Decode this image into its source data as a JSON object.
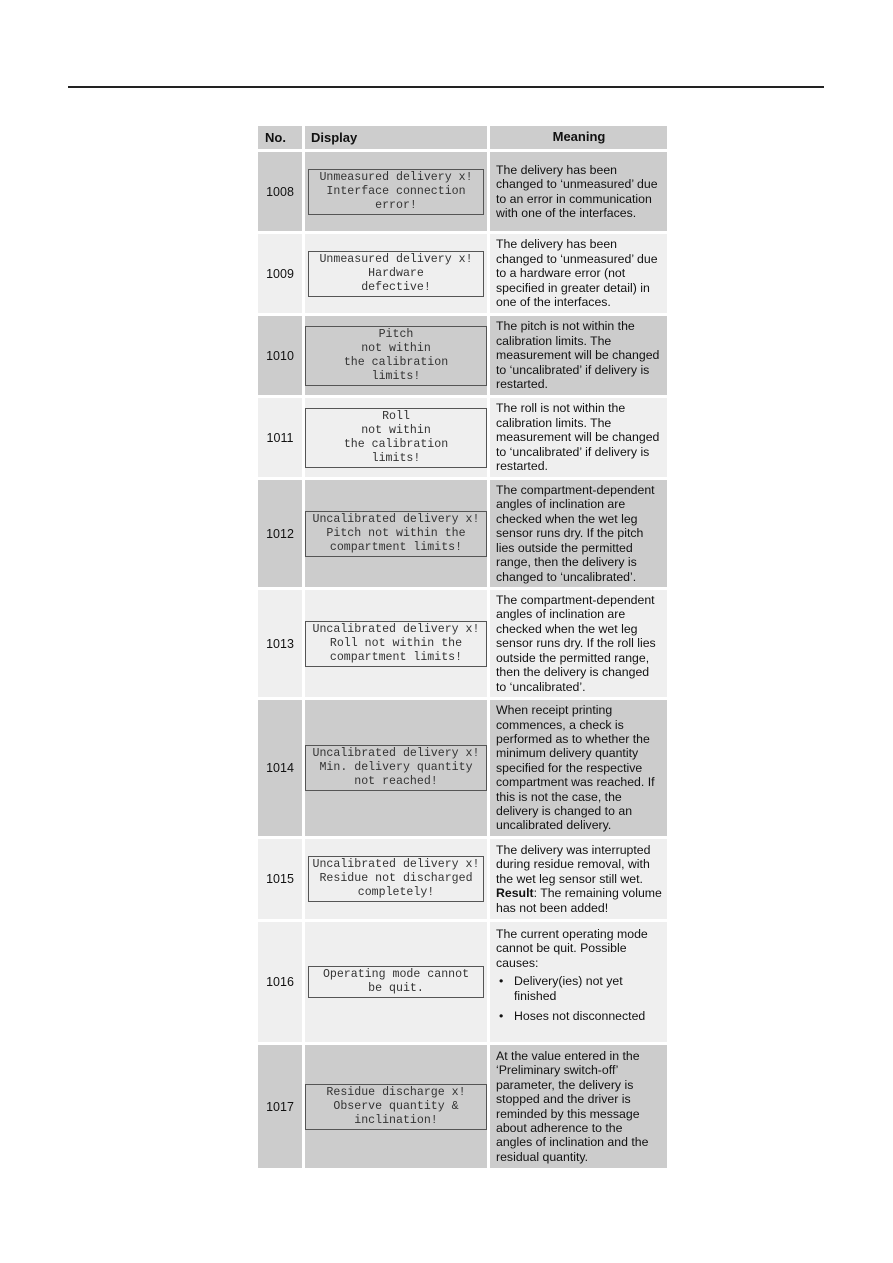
{
  "table": {
    "headers": {
      "no": "No.",
      "display": "Display",
      "meaning": "Meaning"
    },
    "rows": [
      {
        "no": "1008",
        "display": "Unmeasured delivery x!\nInterface connection\nerror!",
        "meaning": "The delivery has been changed to ‘unmeasured’ due to an error in communication with one of the interfaces."
      },
      {
        "no": "1009",
        "display": "Unmeasured delivery x!\nHardware\ndefective!",
        "meaning": "The delivery has been changed to ‘unmeasured’ due to a hardware error (not specified in greater detail) in one of the interfaces."
      },
      {
        "no": "1010",
        "display": "Pitch\nnot within\nthe calibration\nlimits!",
        "meaning": "The pitch is not within the calibration limits. The measurement will be changed to ‘uncalibrated’ if delivery is restarted."
      },
      {
        "no": "1011",
        "display": "Roll\nnot within\nthe calibration\nlimits!",
        "meaning": "The roll is not within the calibration limits. The measurement will be changed to ‘uncalibrated’ if delivery is restarted."
      },
      {
        "no": "1012",
        "display": "Uncalibrated delivery x!\nPitch not within the\ncompartment limits!",
        "meaning": "The compartment-dependent angles of inclination are checked when the wet leg sensor runs dry. If the pitch lies outside the permitted range, then the delivery is changed to ‘uncalibrated’."
      },
      {
        "no": "1013",
        "display": "Uncalibrated delivery x!\nRoll not within the\ncompartment limits!",
        "meaning": "The compartment-dependent angles of inclination are checked when the wet leg sensor runs dry. If the roll lies outside the permitted range, then the delivery is changed to ‘uncalibrated’."
      },
      {
        "no": "1014",
        "display": "Uncalibrated delivery x!\nMin. delivery quantity\nnot reached!",
        "meaning": "When receipt printing commences, a check is performed as to whether the minimum delivery quantity specified for the respective compartment was reached. If this is not the case, the delivery is changed to an uncalibrated delivery."
      },
      {
        "no": "1015",
        "display": "Uncalibrated delivery x!\nResidue not discharged\ncompletely!",
        "meaning": "The delivery was interrupted during residue removal, with the wet leg sensor still wet.",
        "result_label": "Result",
        "result_text": ": The remaining volume has not been added!"
      },
      {
        "no": "1016",
        "display": "Operating mode cannot\nbe quit.",
        "meaning": "The current operating mode cannot be quit. Possible causes:",
        "bullets": [
          "Delivery(ies) not yet finished",
          "Hoses not disconnected"
        ]
      },
      {
        "no": "1017",
        "display": "Residue discharge x!\nObserve quantity &\ninclination!",
        "meaning": "At the value entered in the ‘Preliminary switch-off’ parameter, the delivery is stopped and the driver is reminded by this message about adherence to the angles of inclination and the residual quantity."
      }
    ]
  }
}
